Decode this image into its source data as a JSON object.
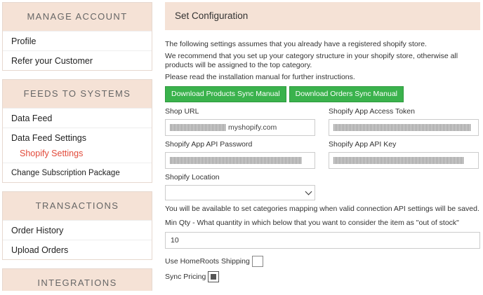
{
  "sidebar": {
    "manage_account": {
      "title": "MANAGE ACCOUNT",
      "items": [
        "Profile",
        "Refer your Customer"
      ]
    },
    "feeds": {
      "title": "FEEDS TO SYSTEMS",
      "items": [
        "Data Feed",
        "Data Feed Settings",
        "Shopify Settings",
        "Change Subscription Package"
      ]
    },
    "transactions": {
      "title": "TRANSACTIONS",
      "items": [
        "Order History",
        "Upload Orders"
      ]
    },
    "integrations": {
      "title": "INTEGRATIONS"
    }
  },
  "main": {
    "title": "Set Configuration",
    "para1": "The following settings assumes that you already have a registered shopify store.",
    "para2": "We recommend that you set up your category structure in your shopify store, otherwise all products will be assigned to the top category.",
    "para3": "Please read the installation manual for further instructions.",
    "btn_products": "Download Products Sync Manual",
    "btn_orders": "Download Orders Sync Manual",
    "shop_url_label": "Shop URL",
    "shop_url_suffix": "myshopify.com",
    "access_token_label": "Shopify App Access Token",
    "api_password_label": "Shopify App API Password",
    "api_key_label": "Shopify App API Key",
    "location_label": "Shopify Location",
    "mapping_note": "You will be available to set categories mapping when valid connection API settings will be saved.",
    "min_qty_label": "Min Qty - What quantity in which below that you want to consider the item as \"out of stock\"",
    "min_qty_value": "10",
    "homeroots_label": "Use HomeRoots Shipping",
    "sync_pricing_label": "Sync Pricing"
  }
}
